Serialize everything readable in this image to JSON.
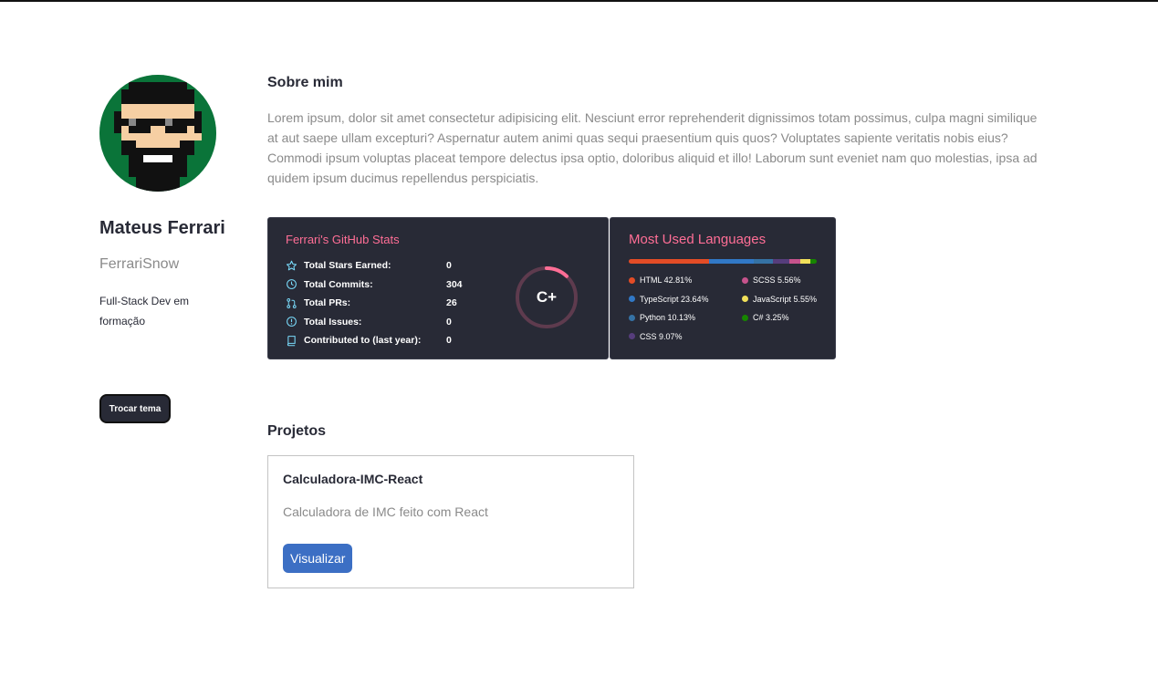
{
  "profile": {
    "name": "Mateus Ferrari",
    "username": "FerrariSnow",
    "bio": "Full-Stack Dev em formação",
    "theme_button": "Trocar tema"
  },
  "about": {
    "title": "Sobre mim",
    "text": "Lorem ipsum, dolor sit amet consectetur adipisicing elit. Nesciunt error reprehenderit dignissimos totam possimus, culpa magni similique at aut saepe ullam excepturi? Aspernatur autem animi quas sequi praesentium quis quos? Voluptates sapiente veritatis nobis eius? Commodi ipsum voluptas placeat tempore delectus ipsa optio, doloribus aliquid et illo! Laborum sunt eveniet nam quo molestias, ipsa ad quidem ipsum ducimus repellendus perspiciatis."
  },
  "github_stats": {
    "title": "Ferrari's GitHub Stats",
    "stats": [
      {
        "icon": "star-icon",
        "label": "Total Stars Earned:",
        "value": "0"
      },
      {
        "icon": "history-icon",
        "label": "Total Commits:",
        "value": "304"
      },
      {
        "icon": "pull-request-icon",
        "label": "Total PRs:",
        "value": "26"
      },
      {
        "icon": "issue-icon",
        "label": "Total Issues:",
        "value": "0"
      },
      {
        "icon": "repo-icon",
        "label": "Contributed to (last year):",
        "value": "0"
      }
    ],
    "rank": "C+",
    "rank_progress": 0.12,
    "accent_color": "#ff6e96",
    "background_color": "#282a36"
  },
  "languages": {
    "title": "Most Used Languages",
    "items": [
      {
        "name": "HTML",
        "percent": "42.81%",
        "value": 42.81,
        "color": "#e34c26"
      },
      {
        "name": "SCSS",
        "percent": "5.56%",
        "value": 5.56,
        "color": "#c6538c"
      },
      {
        "name": "TypeScript",
        "percent": "23.64%",
        "value": 23.64,
        "color": "#3178c6"
      },
      {
        "name": "JavaScript",
        "percent": "5.55%",
        "value": 5.55,
        "color": "#f1e05a"
      },
      {
        "name": "Python",
        "percent": "10.13%",
        "value": 10.13,
        "color": "#3572a5"
      },
      {
        "name": "C#",
        "percent": "3.25%",
        "value": 3.25,
        "color": "#178600"
      },
      {
        "name": "CSS",
        "percent": "9.07%",
        "value": 9.07,
        "color": "#563d7c"
      }
    ],
    "bar_order": [
      "HTML",
      "TypeScript",
      "Python",
      "CSS",
      "SCSS",
      "JavaScript",
      "C#"
    ]
  },
  "projects": {
    "title": "Projetos",
    "items": [
      {
        "name": "Calculadora-IMC-React",
        "description": "Calculadora de IMC feito com React",
        "button": "Visualizar"
      }
    ]
  }
}
